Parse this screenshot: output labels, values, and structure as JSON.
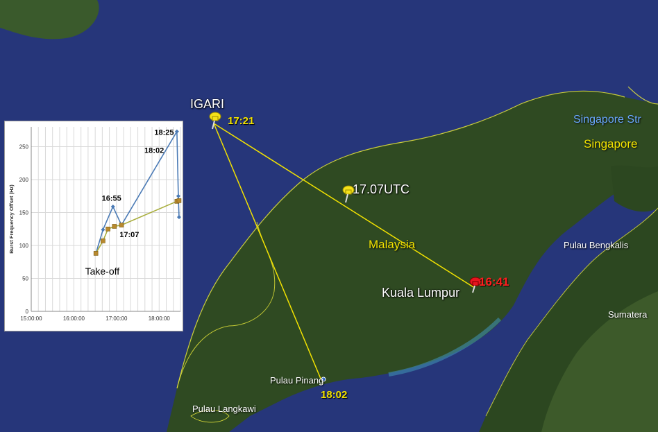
{
  "map": {
    "labels": {
      "igari": "IGARI",
      "t_1721": "17:21",
      "t_1707utc": "17.07UTC",
      "malaysia": "Malaysia",
      "kuala_lumpur": "Kuala Lumpur",
      "t_1641": "16:41",
      "pulau_pinang": "Pulau Pinang",
      "t_1802": "18:02",
      "pulau_langkawi": "Pulau Langkawi",
      "singapore_strait": "Singapore Str",
      "singapore": "Singapore",
      "pulau_bengkalis": "Pulau Bengkalis",
      "sumatera": "Sumatera"
    },
    "colors": {
      "sea": "#26367a",
      "land": "#2f4a22",
      "route": "#f2e200",
      "pin_yellow": "#f5e21a",
      "pin_red": "#e8141e"
    }
  },
  "chart_data": {
    "type": "line",
    "ylabel": "Burst Frequency Offset (Hz)",
    "xlabel": "",
    "x_ticks": [
      "15:00:00",
      "16:00:00",
      "17:00:00",
      "18:00:00"
    ],
    "y_ticks": [
      "0",
      "50",
      "100",
      "150",
      "200",
      "250"
    ],
    "ylim": [
      0,
      280
    ],
    "grid": true,
    "series": [
      {
        "color": "#4a7ab5",
        "points": [
          [
            "16:31",
            88
          ],
          [
            "16:41",
            124
          ],
          [
            "16:55",
            159
          ],
          [
            "17:07",
            131
          ],
          [
            "18:25",
            273
          ],
          [
            "18:27",
            175
          ],
          [
            "18:28",
            143
          ]
        ]
      },
      {
        "color": "#a8ad3c",
        "points": [
          [
            "16:31",
            88
          ],
          [
            "16:41",
            107
          ],
          [
            "16:48",
            125
          ],
          [
            "16:57",
            129
          ],
          [
            "17:07",
            131
          ],
          [
            "18:25",
            167
          ],
          [
            "18:28",
            168
          ]
        ]
      }
    ],
    "annotations": [
      "18:25",
      "18:02",
      "16:55",
      "17:07",
      "Take-off"
    ]
  }
}
